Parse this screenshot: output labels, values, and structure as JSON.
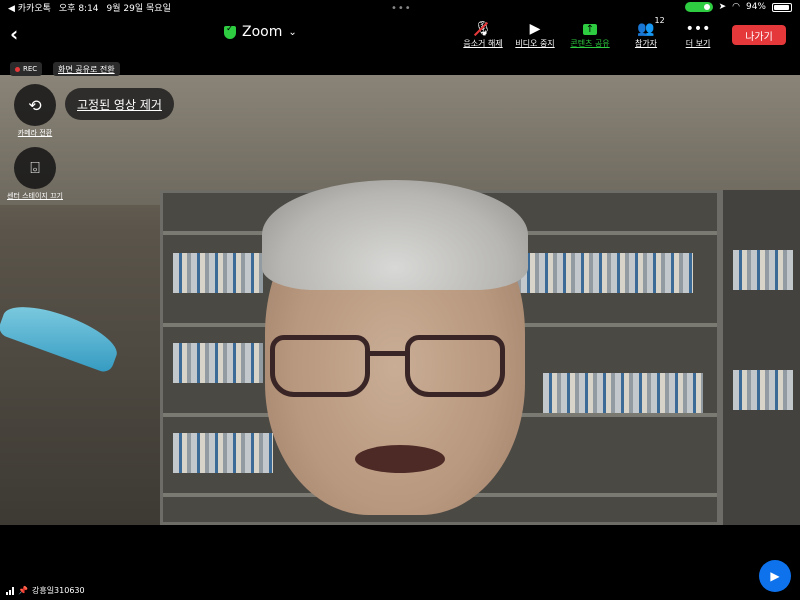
{
  "status_bar": {
    "back_app": "◀ 카카오톡",
    "time": "오후 8:14",
    "date": "9월 29일 목요일",
    "battery": "94%"
  },
  "toolbar": {
    "meeting_title": "Zoom",
    "buttons": [
      {
        "label": "음소거 해제",
        "icon": "mic-off-icon"
      },
      {
        "label": "비디오 중지",
        "icon": "video-camera-icon"
      },
      {
        "label": "콘텐츠 공유",
        "icon": "share-up-arrow-icon"
      },
      {
        "label": "참가자",
        "icon": "participants-icon",
        "count": "12"
      },
      {
        "label": "더 보기",
        "icon": "more-dots-icon"
      }
    ],
    "leave_label": "나가기"
  },
  "overlay": {
    "rec_label": "REC",
    "share_switch_label": "화면 공유로 전환",
    "camera_switch_label": "카메라 전환",
    "center_stage_label": "센터 스테이지 끄기",
    "unpin_label": "고정된 영상 제거"
  },
  "bottom": {
    "participant_name": "강흥일310630"
  },
  "colors": {
    "share_green": "#2ecc40",
    "leave_red": "#e5383b",
    "zoom_blue": "#0e72ed"
  }
}
